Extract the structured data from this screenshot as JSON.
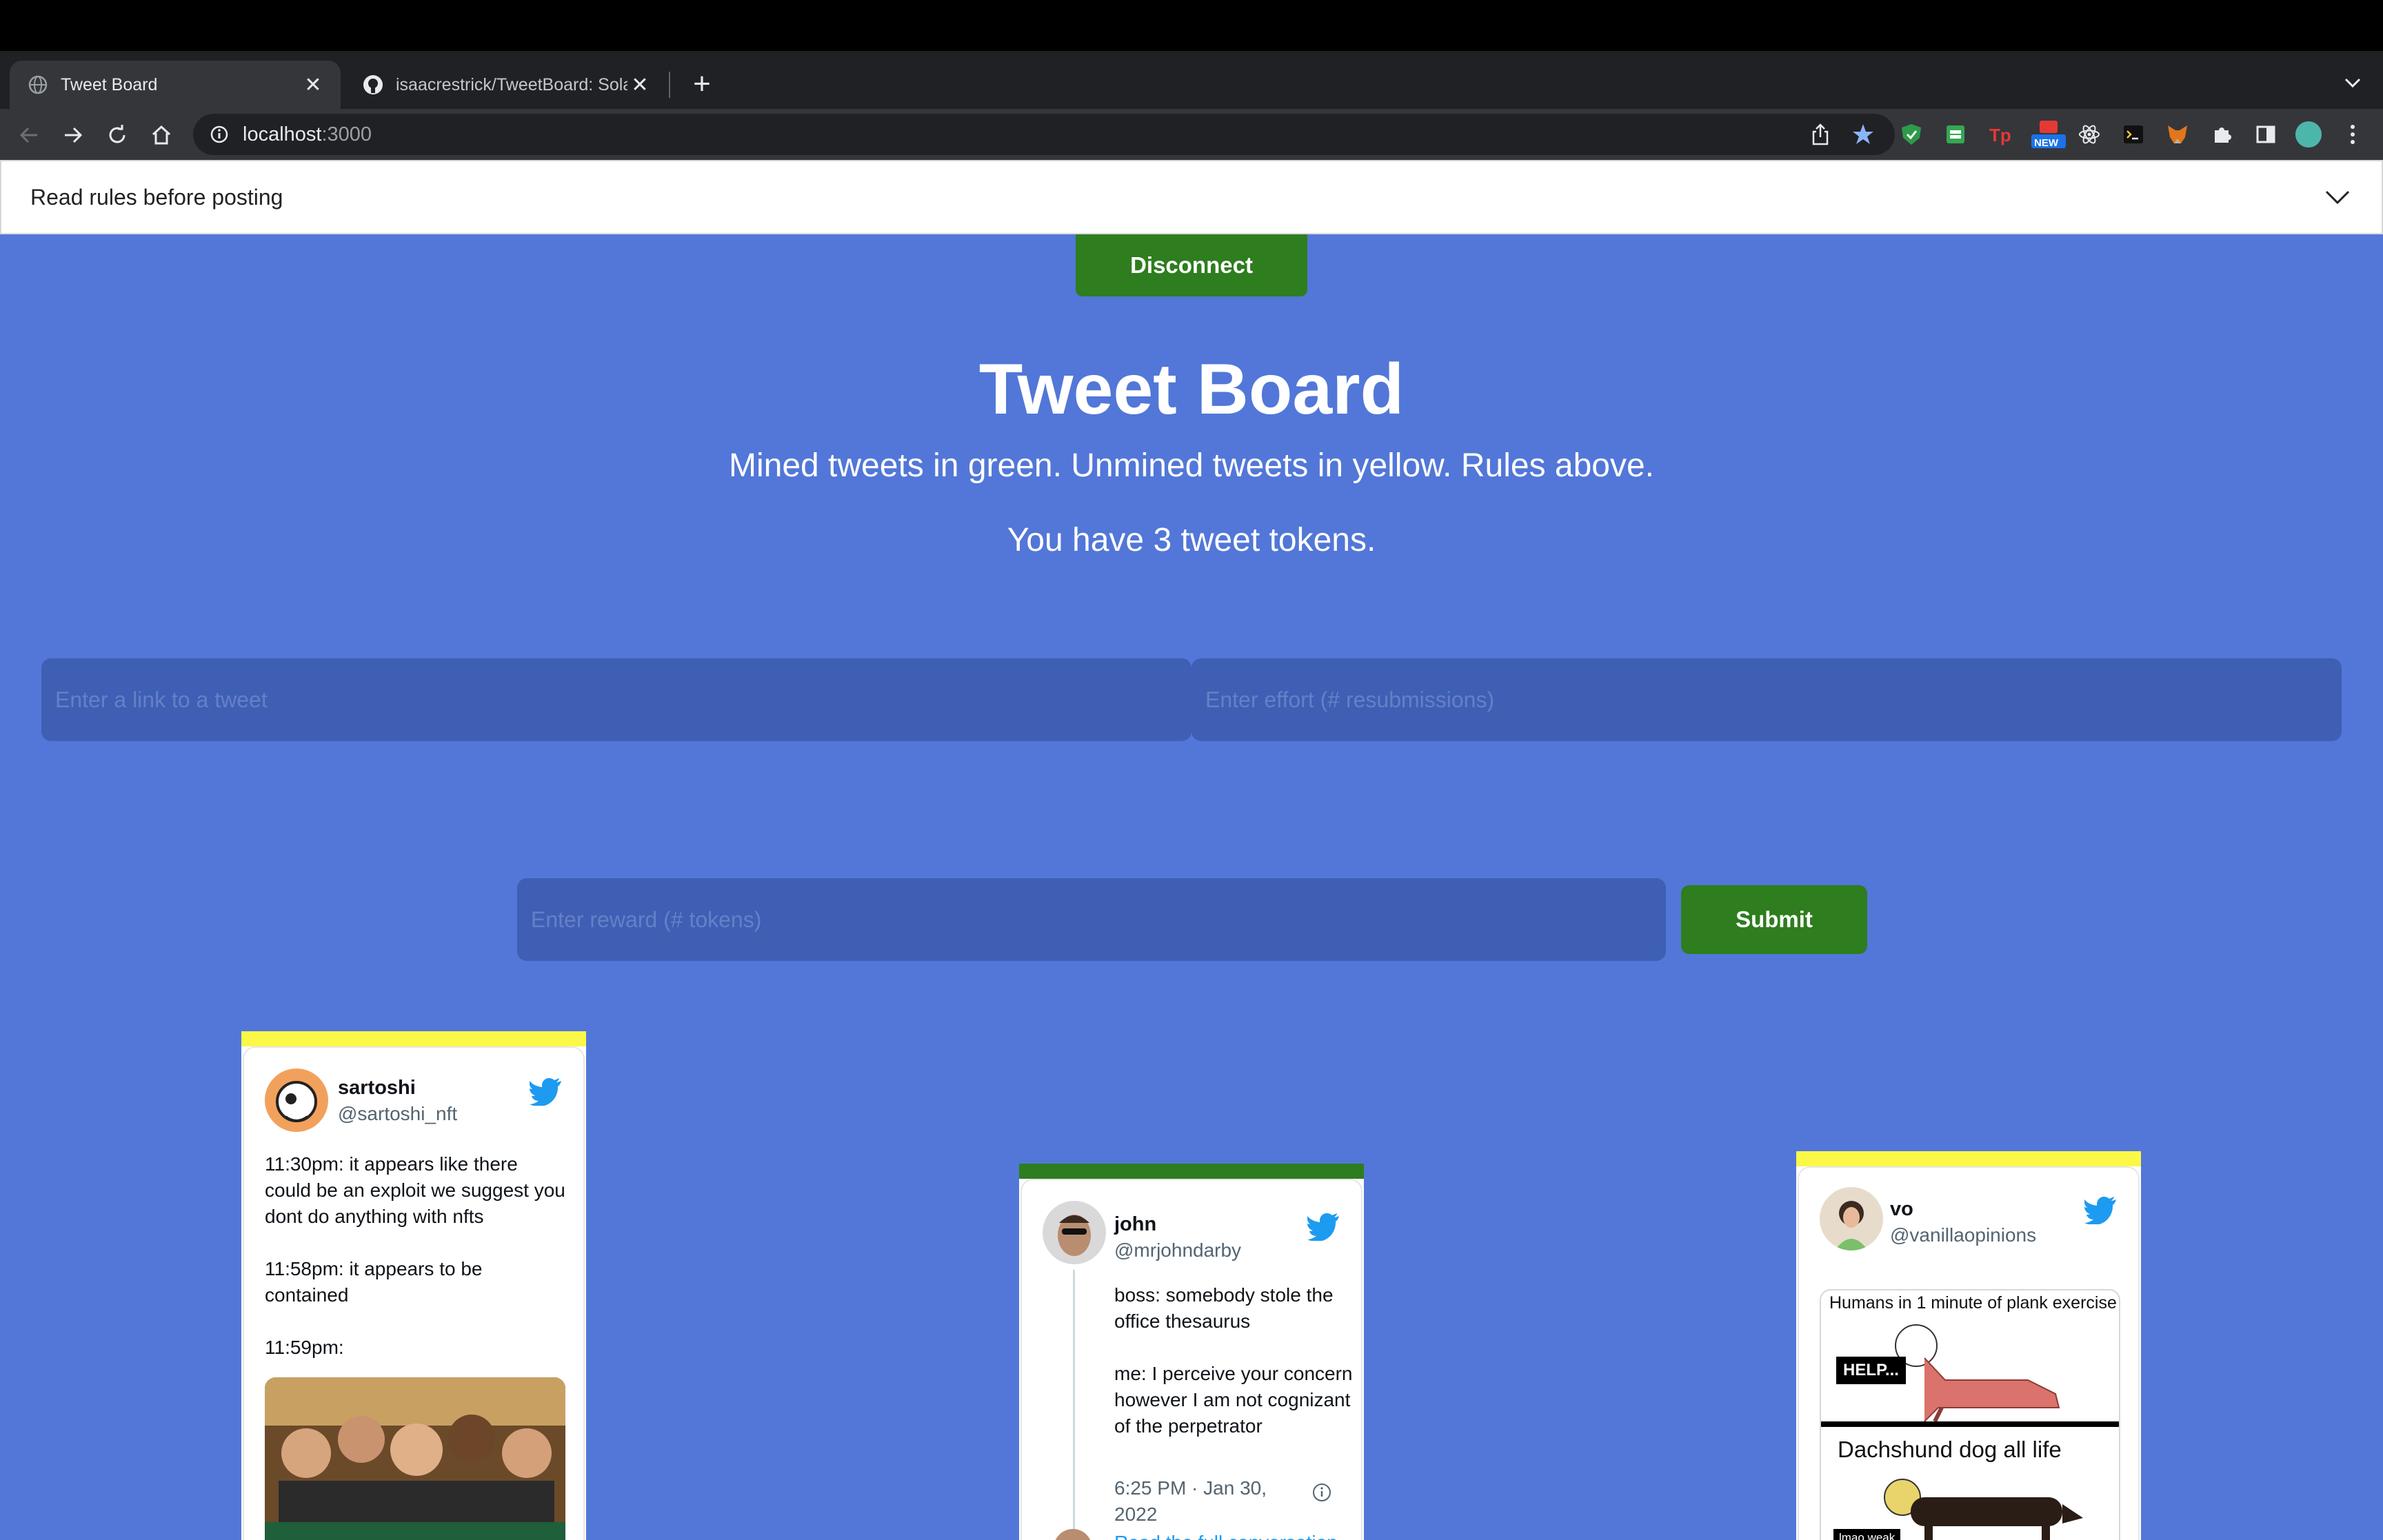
{
  "browser": {
    "tabs": [
      {
        "title": "Tweet Board",
        "active": true
      },
      {
        "title": "isaacrestrick/TweetBoard: Sola",
        "active": false
      }
    ],
    "url_host": "localhost",
    "url_port": ":3000",
    "extension_badge": "NEW"
  },
  "rules": {
    "label": "Read rules before posting"
  },
  "header": {
    "disconnect_label": "Disconnect",
    "title": "Tweet Board",
    "subtitle": "Mined tweets in green. Unmined tweets in yellow. Rules above.",
    "tokens": "You have 3 tweet tokens."
  },
  "form": {
    "link_placeholder": "Enter a link to a tweet",
    "effort_placeholder": "Enter effort (# resubmissions)",
    "reward_placeholder": "Enter reward (# tokens)",
    "submit_label": "Submit"
  },
  "colors": {
    "mined": "#2e7d1e",
    "unmined": "#fbf847",
    "background": "#5277d8"
  },
  "tweets": [
    {
      "status": "unmined",
      "name": "sartoshi",
      "handle": "@sartoshi_nft",
      "text": "11:30pm: it appears like there could be an exploit we suggest you dont do anything with nfts\n\n11:58pm: it appears to be contained\n\n11:59pm:"
    },
    {
      "status": "mined",
      "name": "john",
      "handle": "@mrjohndarby",
      "text": "boss: somebody stole the office thesaurus\n\nme: I perceive your concern however I am not cognizant of the perpetrator",
      "timestamp": "6:25 PM · Jan 30, 2022",
      "read_more": "Read the full conversation"
    },
    {
      "status": "unmined",
      "name": "vo",
      "handle": "@vanillaopinions",
      "meme_top": "Humans in 1 minute of plank exercise",
      "meme_help": "HELP...",
      "meme_bottom": "Dachshund dog all life",
      "meme_tag": "lmao weak"
    }
  ]
}
